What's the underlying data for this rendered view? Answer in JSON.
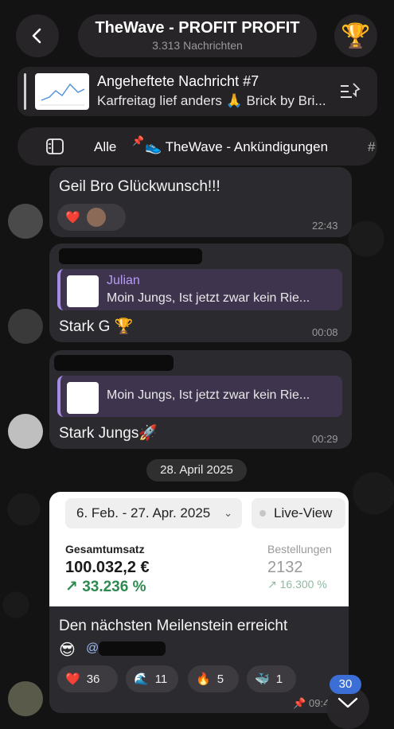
{
  "header": {
    "title": "TheWave - PROFIT PROFIT",
    "subtitle": "3.313 Nachrichten"
  },
  "pinned": {
    "title": "Angeheftete Nachricht #7",
    "preview": "Karfreitag lief anders 🙏 Brick by Bri..."
  },
  "tabs": {
    "all_label": "Alle",
    "announcements_label": "👟 TheWave - Ankündigungen",
    "hash": "#"
  },
  "messages": [
    {
      "text": "Geil Bro Glückwunsch!!!",
      "time": "22:43",
      "reaction": "❤️"
    },
    {
      "reply_name": "Julian",
      "reply_text": "Moin Jungs, Ist jetzt zwar kein Rie...",
      "text": "Stark G 🏆",
      "time": "00:08"
    },
    {
      "reply_text": "Moin Jungs, Ist jetzt zwar kein Rie...",
      "text": "Stark Jungs🚀",
      "time": "00:29"
    }
  ],
  "date_divider": "28. April 2025",
  "stats_card": {
    "date_range": "6. Feb. - 27. Apr. 2025",
    "live_view": "Live-View",
    "revenue_label": "Gesamtumsatz",
    "revenue_value": "100.032,2 €",
    "revenue_growth": "↗ 33.236 %",
    "orders_label": "Bestellungen",
    "orders_value": "2132",
    "orders_growth": "↗ 16.300 %"
  },
  "last_message": {
    "text": "Den nächsten Meilenstein erreicht",
    "emoji": "😎",
    "mention": "@",
    "time": "09:4",
    "reactions": [
      {
        "emoji": "❤️",
        "count": "36"
      },
      {
        "emoji": "🌊",
        "count": "11"
      },
      {
        "emoji": "🔥",
        "count": "5"
      },
      {
        "emoji": "🐳",
        "count": "1"
      }
    ]
  },
  "scroll_badge": "30",
  "colors": {
    "background": "#141314",
    "bubble": "#2b2a2e",
    "accent": "#b69cf5",
    "growth": "#2f8a52",
    "badge": "#3b6fd6"
  }
}
